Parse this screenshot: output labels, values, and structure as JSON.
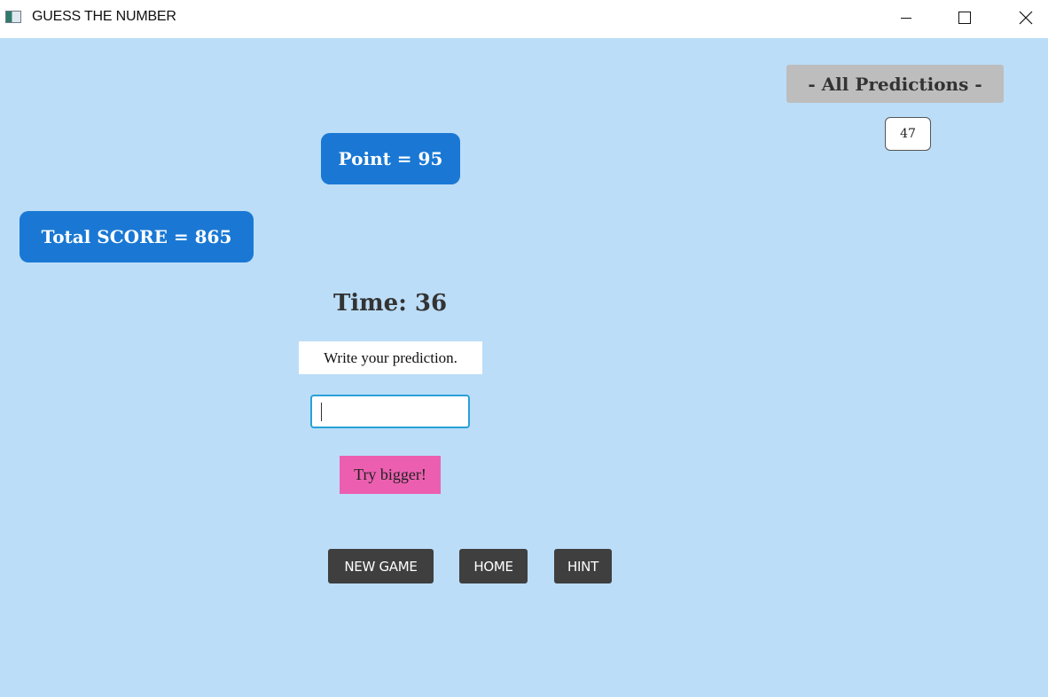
{
  "window": {
    "title": "GUESS THE NUMBER",
    "controls": {
      "minimize": "minimize-icon",
      "maximize": "maximize-icon",
      "close": "close-icon"
    }
  },
  "colors": {
    "background": "#bbddf8",
    "score_pill": "#1a78d4",
    "predictions_header": "#bdbdbd",
    "hint_message": "#ec5fb0",
    "button": "#3f3f3f",
    "input_border": "#2aa0d8"
  },
  "scores": {
    "point": "Point = 95",
    "total": "Total SCORE = 865"
  },
  "predictions": {
    "header": "- All Predictions -",
    "items": [
      "47"
    ]
  },
  "game": {
    "time": "Time: 36",
    "prompt": "Write your prediction.",
    "input_value": "",
    "hint_message": "Try bigger!"
  },
  "buttons": {
    "new_game": "NEW GAME",
    "home": "HOME",
    "hint": "HINT"
  }
}
